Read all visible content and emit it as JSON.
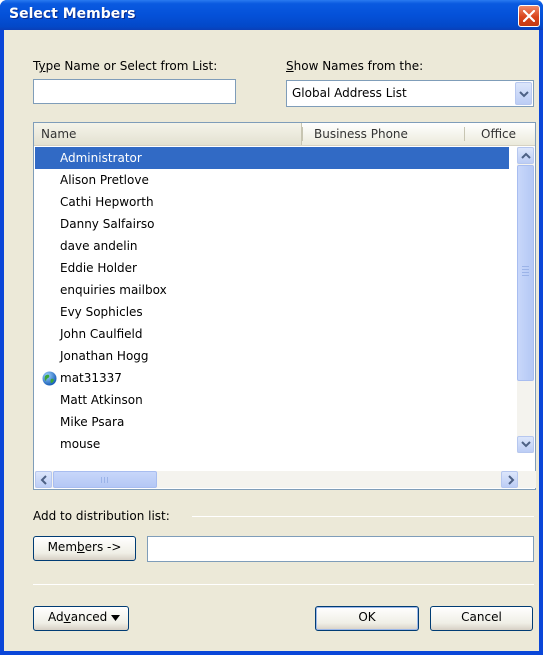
{
  "window": {
    "title": "Select Members"
  },
  "search": {
    "label_pre": "T",
    "label_key": "y",
    "label_post": "pe Name or Select from List:",
    "value": ""
  },
  "show_names": {
    "label_key": "S",
    "label_post": "how Names from the:",
    "selected": "Global Address List"
  },
  "list": {
    "columns": [
      "Name",
      "Business Phone",
      "Office"
    ],
    "rows": [
      {
        "name": "Administrator",
        "selected": true,
        "icon": ""
      },
      {
        "name": "Alison Pretlove",
        "selected": false,
        "icon": ""
      },
      {
        "name": "Cathi Hepworth",
        "selected": false,
        "icon": ""
      },
      {
        "name": "Danny Salfairso",
        "selected": false,
        "icon": ""
      },
      {
        "name": "dave andelin",
        "selected": false,
        "icon": ""
      },
      {
        "name": "Eddie Holder",
        "selected": false,
        "icon": ""
      },
      {
        "name": "enquiries mailbox",
        "selected": false,
        "icon": ""
      },
      {
        "name": "Evy Sophicles",
        "selected": false,
        "icon": ""
      },
      {
        "name": "John Caulfield",
        "selected": false,
        "icon": ""
      },
      {
        "name": "Jonathan Hogg",
        "selected": false,
        "icon": ""
      },
      {
        "name": "mat31337",
        "selected": false,
        "icon": "globe-icon"
      },
      {
        "name": "Matt Atkinson",
        "selected": false,
        "icon": ""
      },
      {
        "name": "Mike Psara",
        "selected": false,
        "icon": ""
      },
      {
        "name": "mouse",
        "selected": false,
        "icon": ""
      }
    ]
  },
  "distribution": {
    "label": "Add to distribution list:",
    "members_pre": "Mem",
    "members_key": "b",
    "members_post": "ers ->",
    "value": ""
  },
  "buttons": {
    "advanced_pre": "Ad",
    "advanced_key": "v",
    "advanced_post": "anced",
    "ok": "OK",
    "cancel": "Cancel"
  },
  "colors": {
    "titlebar": "#0451d9",
    "selection": "#316ac5",
    "dialog_bg": "#ece9d8"
  }
}
